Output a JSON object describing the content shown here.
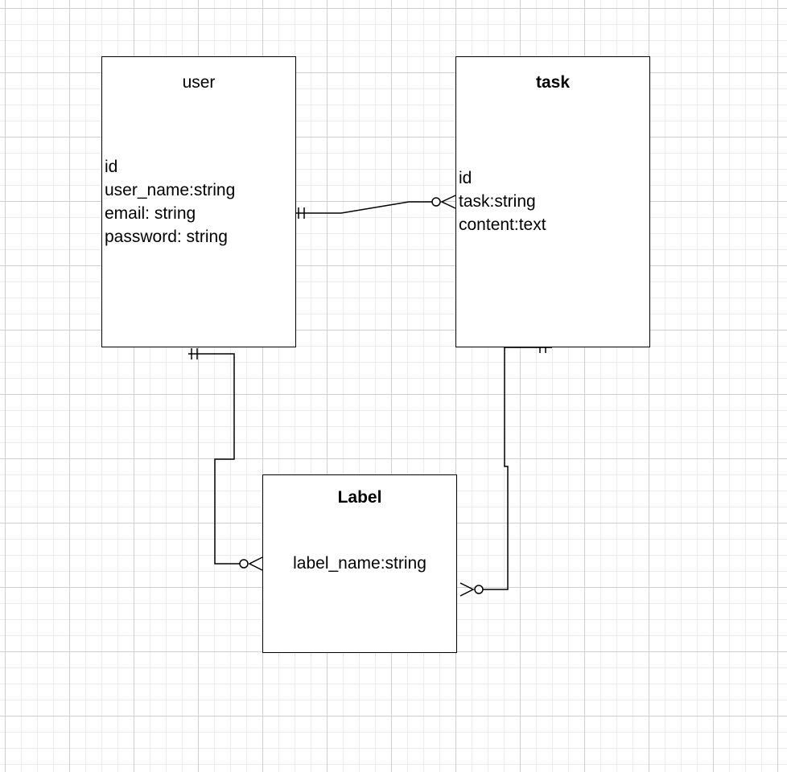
{
  "entities": {
    "user": {
      "title": "user",
      "attributes": [
        "id",
        "user_name:string",
        "email: string",
        "password: string"
      ]
    },
    "task": {
      "title": "task",
      "attributes": [
        "id",
        "task:string",
        "content:text"
      ]
    },
    "label": {
      "title": "Label",
      "attributes": [
        "label_name:string"
      ]
    }
  },
  "relationships": [
    {
      "from": "user",
      "to": "task",
      "from_cardinality": "one-and-only-one",
      "to_cardinality": "zero-or-many"
    },
    {
      "from": "user",
      "to": "label",
      "from_cardinality": "one-and-only-one",
      "to_cardinality": "zero-or-many"
    },
    {
      "from": "task",
      "to": "label",
      "from_cardinality": "one-and-only-one",
      "to_cardinality": "zero-or-many"
    }
  ],
  "colors": {
    "line": "#000000",
    "grid_major": "#cfcfcf",
    "grid_minor": "#ececec",
    "background": "#ffffff"
  }
}
